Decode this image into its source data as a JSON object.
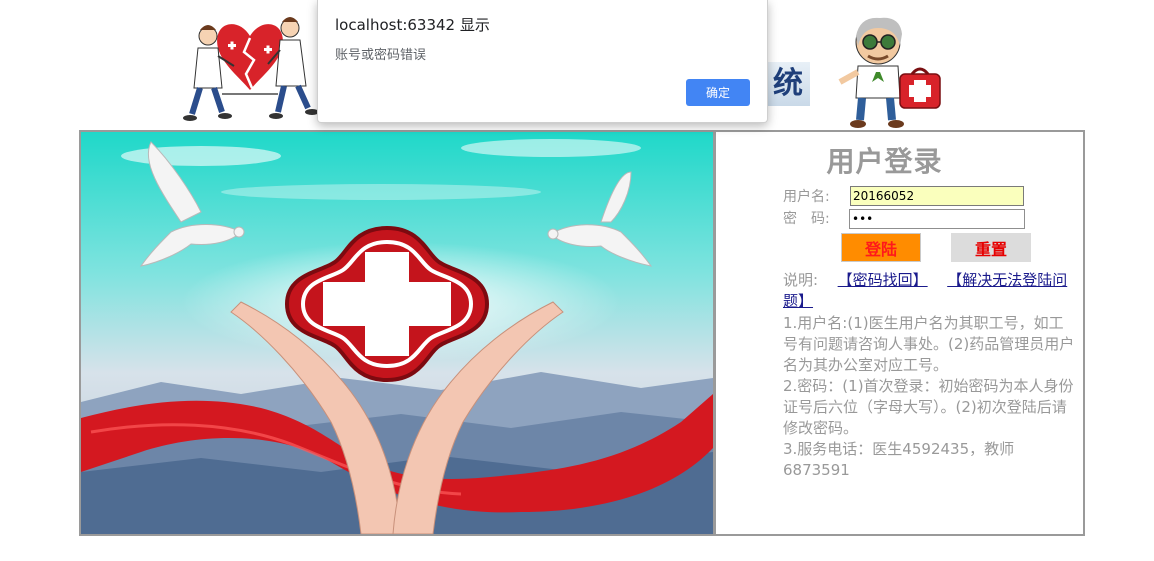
{
  "alert": {
    "title": "localhost:63342 显示",
    "message": "账号或密码错误",
    "ok_label": "确定"
  },
  "header": {
    "title_fragment": "统"
  },
  "login": {
    "title": "用户登录",
    "username_label": "用户名:",
    "username_value": "20166052",
    "password_label": "密　码:",
    "password_value": "•••",
    "login_button": "登陆",
    "reset_button": "重置",
    "notes_label": "说明:",
    "link_recover": "【密码找回】",
    "link_help": "【解决无法登陆问题】",
    "note_1": "1.用户名:(1)医生用户名为其职工号，如工号有问题请咨询人事处。(2)药品管理员用户名为其办公室对应工号。",
    "note_2": "2.密码：(1)首次登录：初始密码为本人身份证号后六位（字母大写）。(2)初次登陆后请修改密码。",
    "note_3": "3.服务电话：医生4592435，教师6873591"
  },
  "colors": {
    "login_button_bg": "#ff8c00",
    "reset_button_bg": "#dcdcdc",
    "alert_button_bg": "#4285f4",
    "autofill_bg": "#faffbd",
    "muted_text": "#999999"
  }
}
